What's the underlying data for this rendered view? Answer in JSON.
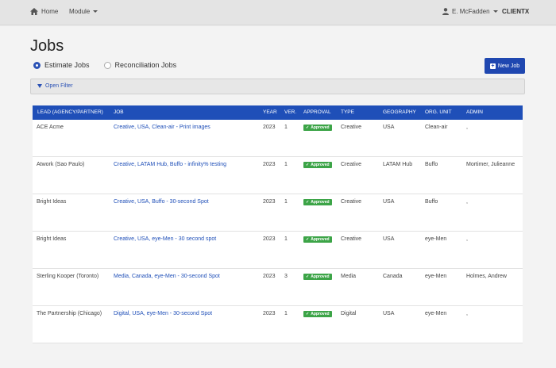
{
  "nav": {
    "home_label": "Home",
    "module_label": "Module",
    "user_label": "E. McFadden",
    "client_label": "CLIENTX"
  },
  "page": {
    "title": "Jobs",
    "radio_estimate": "Estimate Jobs",
    "radio_reconciliation": "Reconciliation Jobs",
    "new_job_label": "New Job",
    "filter_label": "Open Filter"
  },
  "table": {
    "headers": [
      "LEAD (AGENCY/PARTNER)",
      "JOB",
      "YEAR",
      "VER.",
      "APPROVAL",
      "TYPE",
      "GEOGRAPHY",
      "ORG. UNIT",
      "ADMIN"
    ],
    "rows": [
      {
        "lead": "ACE Acme",
        "job": "Creative, USA, Clean-air - Print images",
        "year": "2023",
        "ver": "1",
        "approval": "Approved",
        "type": "Creative",
        "geo": "USA",
        "org": "Clean-air",
        "admin": ","
      },
      {
        "lead": "Atwork (Sao Paulo)",
        "job": "Creative, LATAM Hub, Buffo - infinity% testing",
        "year": "2023",
        "ver": "1",
        "approval": "Approved",
        "type": "Creative",
        "geo": "LATAM Hub",
        "org": "Buffo",
        "admin": "Mortimer, Julieanne"
      },
      {
        "lead": "Bright Ideas",
        "job": "Creative, USA, Buffo - 30-second Spot",
        "year": "2023",
        "ver": "1",
        "approval": "Approved",
        "type": "Creative",
        "geo": "USA",
        "org": "Buffo",
        "admin": ","
      },
      {
        "lead": "Bright Ideas",
        "job": "Creative, USA, eye-Men - 30 second spot",
        "year": "2023",
        "ver": "1",
        "approval": "Approved",
        "type": "Creative",
        "geo": "USA",
        "org": "eye-Men",
        "admin": ","
      },
      {
        "lead": "Sterling Kooper (Toronto)",
        "job": "Media, Canada, eye-Men - 30-second Spot",
        "year": "2023",
        "ver": "3",
        "approval": "Approved",
        "type": "Media",
        "geo": "Canada",
        "org": "eye-Men",
        "admin": "Holmes, Andrew"
      },
      {
        "lead": "The Partnership (Chicago)",
        "job": "Digital, USA, eye-Men - 30-second Spot",
        "year": "2023",
        "ver": "1",
        "approval": "Approved",
        "type": "Digital",
        "geo": "USA",
        "org": "eye-Men",
        "admin": ","
      }
    ]
  },
  "colors": {
    "accent": "#1f4fb8",
    "approved": "#3ca447"
  }
}
